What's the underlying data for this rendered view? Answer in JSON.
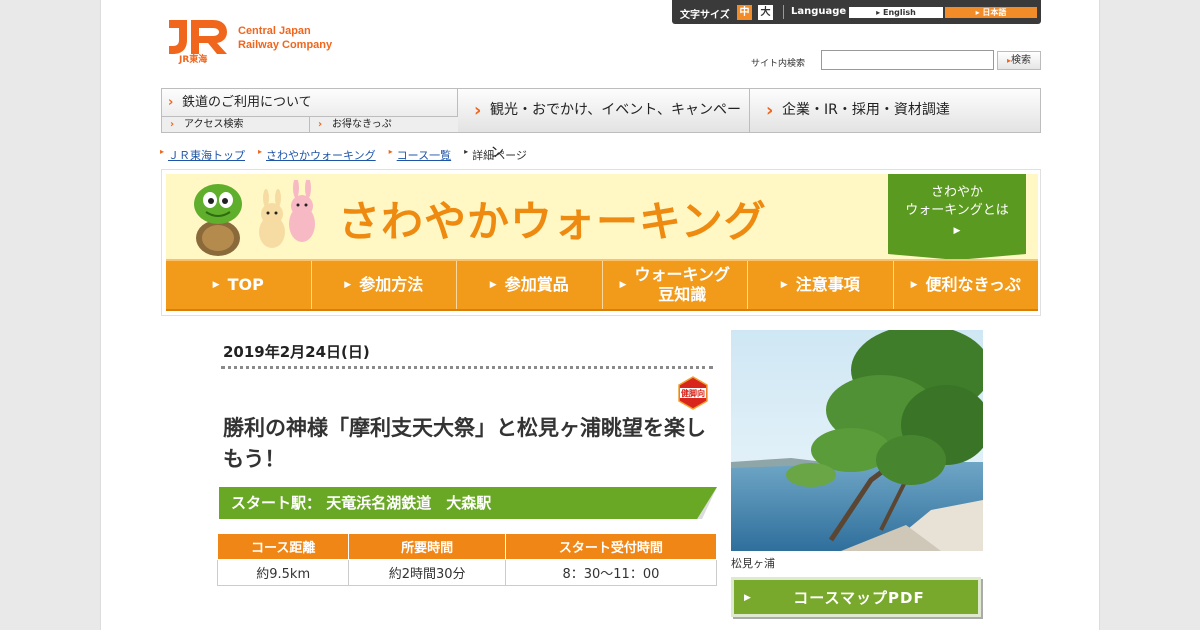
{
  "header": {
    "logo_name_line1": "Central Japan",
    "logo_name_line2": "Railway Company",
    "logo_sub": "JR東海",
    "font_size_label": "文字サイズ",
    "font_size_medium": "中",
    "font_size_large": "大",
    "language_label": "Language",
    "lang_english": "English",
    "lang_japanese": "日本語",
    "search_label": "サイト内検索",
    "search_value": "",
    "search_button": "検索"
  },
  "global_nav": {
    "railway_usage": "鉄道のご利用について",
    "access_search": "アクセス検索",
    "discount_tickets": "お得なきっぷ",
    "tourism": "観光・おでかけ、イベント、キャンペーン",
    "corporate": "企業・IR・採用・資材調達"
  },
  "breadcrumb": [
    "ＪＲ東海トップ",
    "さわやかウォーキング",
    "コース一覧",
    "詳細ページ"
  ],
  "banner": {
    "title": "さわやかウォーキング",
    "about_line1": "さわやか",
    "about_line2": "ウォーキングとは",
    "about_arrow": "▶"
  },
  "sub_nav": [
    "TOP",
    "参加方法",
    "参加賞品",
    "ウォーキング\n豆知識",
    "注意事項",
    "便利なきっぷ"
  ],
  "course": {
    "date": "2019年2月24日(日)",
    "badge": "健脚向",
    "title": "勝利の神様「摩利支天大祭」と松見ヶ浦眺望を楽しもう！",
    "start_station": "スタート駅： 天竜浜名湖鉄道　大森駅",
    "table_headers": [
      "コース距離",
      "所要時間",
      "スタート受付時間"
    ],
    "table_values": [
      "約9.5km",
      "約2時間30分",
      "8：30～11：00"
    ],
    "photo_caption": "松見ヶ浦",
    "pdf_button": "コースマップPDF"
  },
  "colors": {
    "brand_orange": "#f0661c",
    "nav_orange": "#f29a1a",
    "green": "#69a824"
  }
}
